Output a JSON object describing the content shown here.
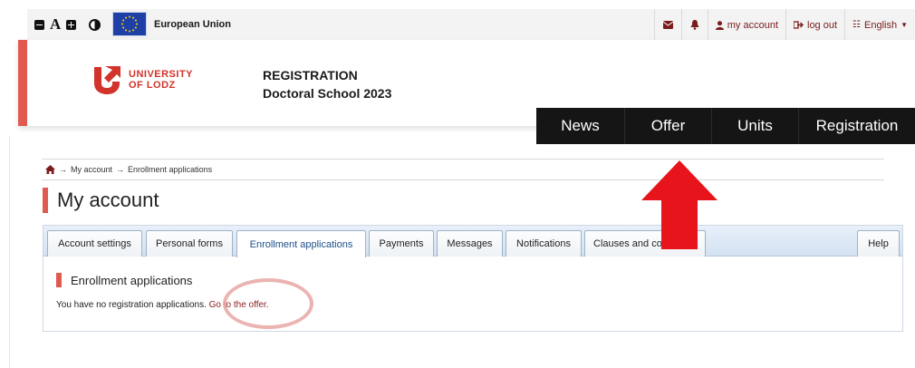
{
  "topbar": {
    "eu_label": "European Union",
    "account_label": "my account",
    "logout_label": "log out",
    "language_label": "English"
  },
  "header": {
    "logo_line1": "UNIVERSITY",
    "logo_line2": "OF LODZ",
    "title_line1": "REGISTRATION",
    "title_line2": "Doctoral School 2023"
  },
  "nav": [
    "News",
    "Offer",
    "Units",
    "Registration"
  ],
  "breadcrumb": [
    "My account",
    "Enrollment applications"
  ],
  "page_title": "My account",
  "tabs": [
    {
      "label": "Account settings"
    },
    {
      "label": "Personal forms"
    },
    {
      "label": "Enrollment applications"
    },
    {
      "label": "Payments"
    },
    {
      "label": "Messages"
    },
    {
      "label": "Notifications"
    },
    {
      "label": "Clauses and co"
    },
    {
      "label": "Help"
    }
  ],
  "section_title": "Enrollment applications",
  "message": "You have no registration applications.",
  "offer_link": "Go to the offer.",
  "colors": {
    "accent_red": "#e05a4f",
    "nav_bg": "#151515",
    "arrow_red": "#e8141c"
  },
  "icons": [
    "contrast-icon",
    "eu-flag-icon",
    "envelope-icon",
    "bell-icon",
    "user-icon",
    "logout-icon",
    "translate-icon",
    "home-icon",
    "arrow-right-icon"
  ]
}
